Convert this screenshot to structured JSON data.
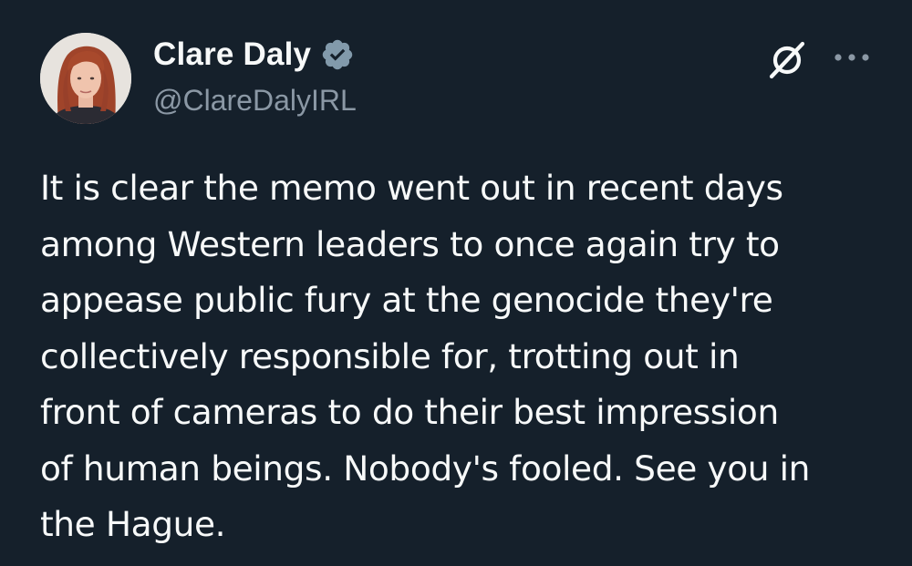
{
  "tweet": {
    "author": {
      "display_name": "Clare Daly",
      "handle": "@ClareDalyIRL",
      "verified": true,
      "verified_icon": "verified-badge-icon",
      "verified_color": "#829aab"
    },
    "actions": {
      "grok_icon": "grok-icon",
      "more_icon": "more-options-icon"
    },
    "text_lines": [
      "It is clear the memo went out in recent days",
      "among Western leaders to once again try to",
      "appease public fury at the genocide they're",
      "collectively responsible for, trotting out in",
      "front of cameras to do their best impression",
      "of human beings. Nobody's fooled. See you in",
      "the Hague."
    ]
  },
  "colors": {
    "background": "#15202b",
    "text_primary": "#f7f9f9",
    "text_secondary": "#8b98a5"
  }
}
